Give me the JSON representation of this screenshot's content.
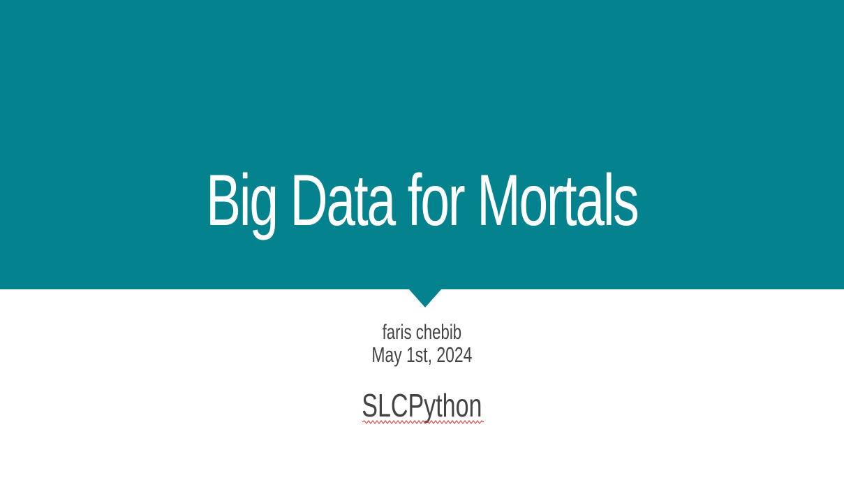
{
  "slide": {
    "title": "Big Data for Mortals",
    "author": "faris chebib",
    "date": "May 1st, 2024",
    "organization": "SLCPython"
  },
  "colors": {
    "banner": "#04838F",
    "title_text": "#FFFFFF",
    "body_text": "#434343",
    "spellcheck_underline": "#D93025"
  }
}
